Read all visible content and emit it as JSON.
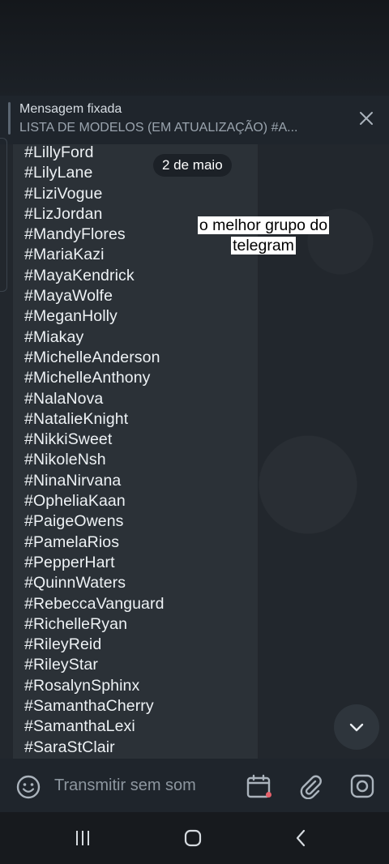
{
  "pinned": {
    "title": "Mensagem fixada",
    "subtitle": "LISTA DE MODELOS (EM ATUALIZAÇÃO)   #A..."
  },
  "chat": {
    "date_chip": "2 de maio",
    "caption": "o melhor grupo do telegram",
    "list_items": [
      "#LillyFord",
      "#LilyLane",
      "#LiziVogue",
      "#LizJordan",
      "#MandyFlores",
      "#MariaKazi",
      "#MayaKendrick",
      "#MayaWolfe",
      "#MeganHolly",
      "#Miakay",
      "#MichelleAnderson",
      "#MichelleAnthony",
      "#NalaNova",
      "#NatalieKnight",
      "#NikkiSweet",
      "#NikoleNsh",
      "#NinaNirvana",
      "#OpheliaKaan",
      "#PaigeOwens",
      "#PamelaRios",
      "#PepperHart",
      "#QuinnWaters",
      "#RebeccaVanguard",
      "#RichelleRyan",
      "#RileyReid",
      "#RileyStar",
      "#RosalynSphinx",
      "#SamanthaCherry",
      "#SamanthaLexi",
      "#SaraStClair"
    ]
  },
  "input": {
    "placeholder": "Transmitir sem som"
  },
  "icons": {
    "close": "close-icon",
    "scroll_down": "chevron-down-icon",
    "emoji": "emoji-icon",
    "schedule": "calendar-icon",
    "attach": "paperclip-icon",
    "camera": "instagram-camera-icon",
    "nav_recents": "recents-icon",
    "nav_home": "home-icon",
    "nav_back": "back-icon"
  },
  "colors": {
    "background": "#22272d",
    "bubble": "#2b3137",
    "caption_bg": "#ffffff",
    "dot": "#e6616b"
  }
}
